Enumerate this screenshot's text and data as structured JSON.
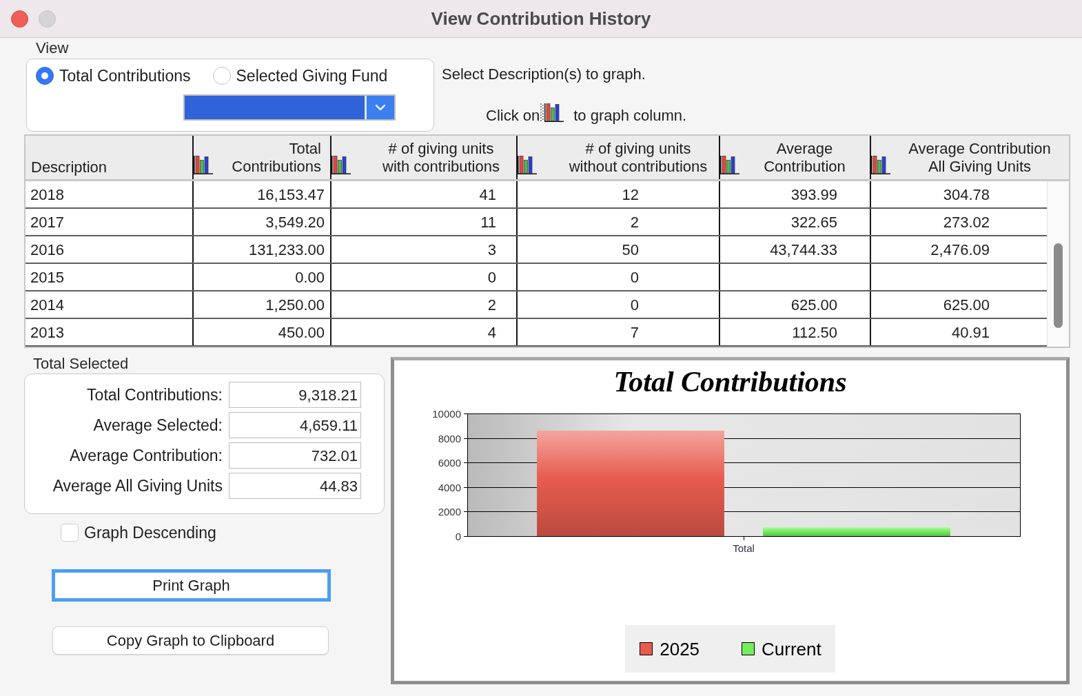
{
  "window": {
    "title": "View Contribution History"
  },
  "view": {
    "label": "View",
    "options": [
      {
        "label": "Total Contributions",
        "selected": true
      },
      {
        "label": "Selected Giving Fund",
        "selected": false
      }
    ]
  },
  "instructions": {
    "select_hint": "Select Description(s) to graph.",
    "click_hint_start": "Click on",
    "click_hint_end": "to graph column."
  },
  "table": {
    "columns": [
      {
        "label": "Description",
        "graph_icon": false
      },
      {
        "label": "Total\nContributions",
        "graph_icon": true
      },
      {
        "label": "# of giving units\nwith contributions",
        "graph_icon": true
      },
      {
        "label": "# of giving units\nwithout contributions",
        "graph_icon": true
      },
      {
        "label": "Average\nContribution",
        "graph_icon": true
      },
      {
        "label": "Average Contribution\nAll Giving Units",
        "graph_icon": true
      }
    ],
    "rows": [
      {
        "description": "2018",
        "total_contributions": "16,153.47",
        "units_with_contributions": "41",
        "units_without_contributions": "12",
        "average_contribution": "393.99",
        "average_all_giving_units": "304.78"
      },
      {
        "description": "2017",
        "total_contributions": "3,549.20",
        "units_with_contributions": "11",
        "units_without_contributions": "2",
        "average_contribution": "322.65",
        "average_all_giving_units": "273.02"
      },
      {
        "description": "2016",
        "total_contributions": "131,233.00",
        "units_with_contributions": "3",
        "units_without_contributions": "50",
        "average_contribution": "43,744.33",
        "average_all_giving_units": "2,476.09"
      },
      {
        "description": "2015",
        "total_contributions": "0.00",
        "units_with_contributions": "0",
        "units_without_contributions": "0"
      },
      {
        "description": "2014",
        "total_contributions": "1,250.00",
        "units_with_contributions": "2",
        "units_without_contributions": "0",
        "average_contribution": "625.00",
        "average_all_giving_units": "625.00"
      },
      {
        "description": "2013",
        "total_contributions": "450.00",
        "units_with_contributions": "4",
        "units_without_contributions": "7",
        "average_contribution": "112.50",
        "average_all_giving_units": "40.91"
      }
    ]
  },
  "total_selected": {
    "label": "Total Selected",
    "fields": [
      {
        "label": "Total Contributions:",
        "value": "9,318.21"
      },
      {
        "label": "Average Selected:",
        "value": "4,659.11"
      },
      {
        "label": "Average Contribution:",
        "value": "732.01"
      },
      {
        "label": "Average All Giving Units",
        "value": "44.83"
      }
    ]
  },
  "graph_descending": {
    "label": "Graph Descending",
    "checked": false
  },
  "buttons": [
    {
      "label": "Print Graph",
      "focused": true
    },
    {
      "label": "Copy Graph to Clipboard",
      "focused": false
    }
  ],
  "chart": {
    "chart_data": {
      "type": "bar",
      "title": "Total Contributions",
      "categories": [
        "Total"
      ],
      "series": [
        {
          "name": "2025",
          "color": "#e85c4e",
          "values": [
            8600
          ]
        },
        {
          "name": "Current",
          "color": "#74ee5d",
          "values": [
            720
          ]
        }
      ],
      "ylim": [
        0,
        10000
      ],
      "yticks": [
        {
          "value": 0,
          "label": "0"
        },
        {
          "value": 2000,
          "label": "2000"
        },
        {
          "value": 4000,
          "label": "4000"
        },
        {
          "value": 6000,
          "label": "6000"
        },
        {
          "value": 8000,
          "label": "8000"
        },
        {
          "value": 10000,
          "label": "10000"
        }
      ],
      "grid": true,
      "legend": true
    }
  }
}
